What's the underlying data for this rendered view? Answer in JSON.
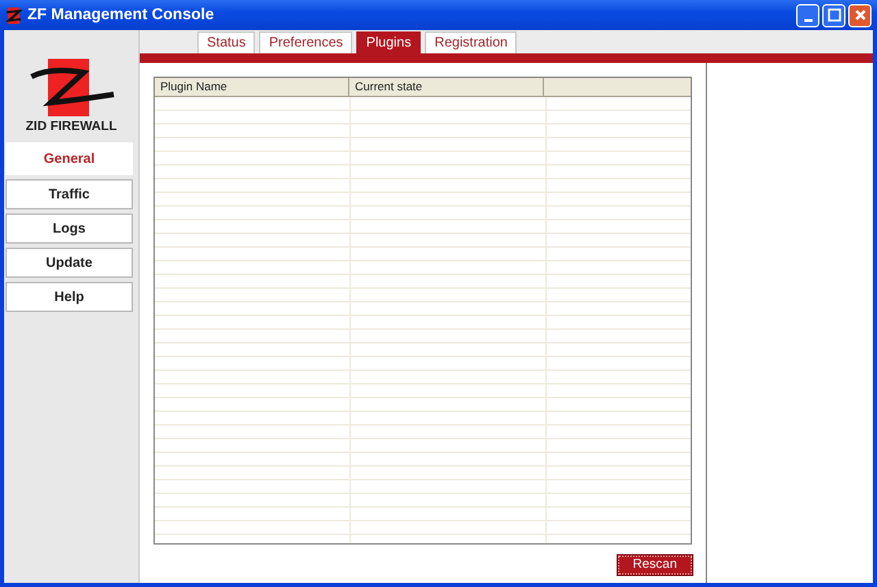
{
  "window": {
    "title": "ZF Management Console"
  },
  "logo": {
    "text": "ZID FIREWALL"
  },
  "nav": [
    {
      "label": "General",
      "selected": true
    },
    {
      "label": "Traffic",
      "selected": false
    },
    {
      "label": "Logs",
      "selected": false
    },
    {
      "label": "Update",
      "selected": false
    },
    {
      "label": "Help",
      "selected": false
    }
  ],
  "tabs": [
    {
      "label": "Status",
      "selected": false
    },
    {
      "label": "Preferences",
      "selected": false
    },
    {
      "label": "Plugins",
      "selected": true
    },
    {
      "label": "Registration",
      "selected": false
    }
  ],
  "table": {
    "columns": [
      "Plugin Name",
      "Current state"
    ]
  },
  "buttons": [
    "Rescan"
  ]
}
